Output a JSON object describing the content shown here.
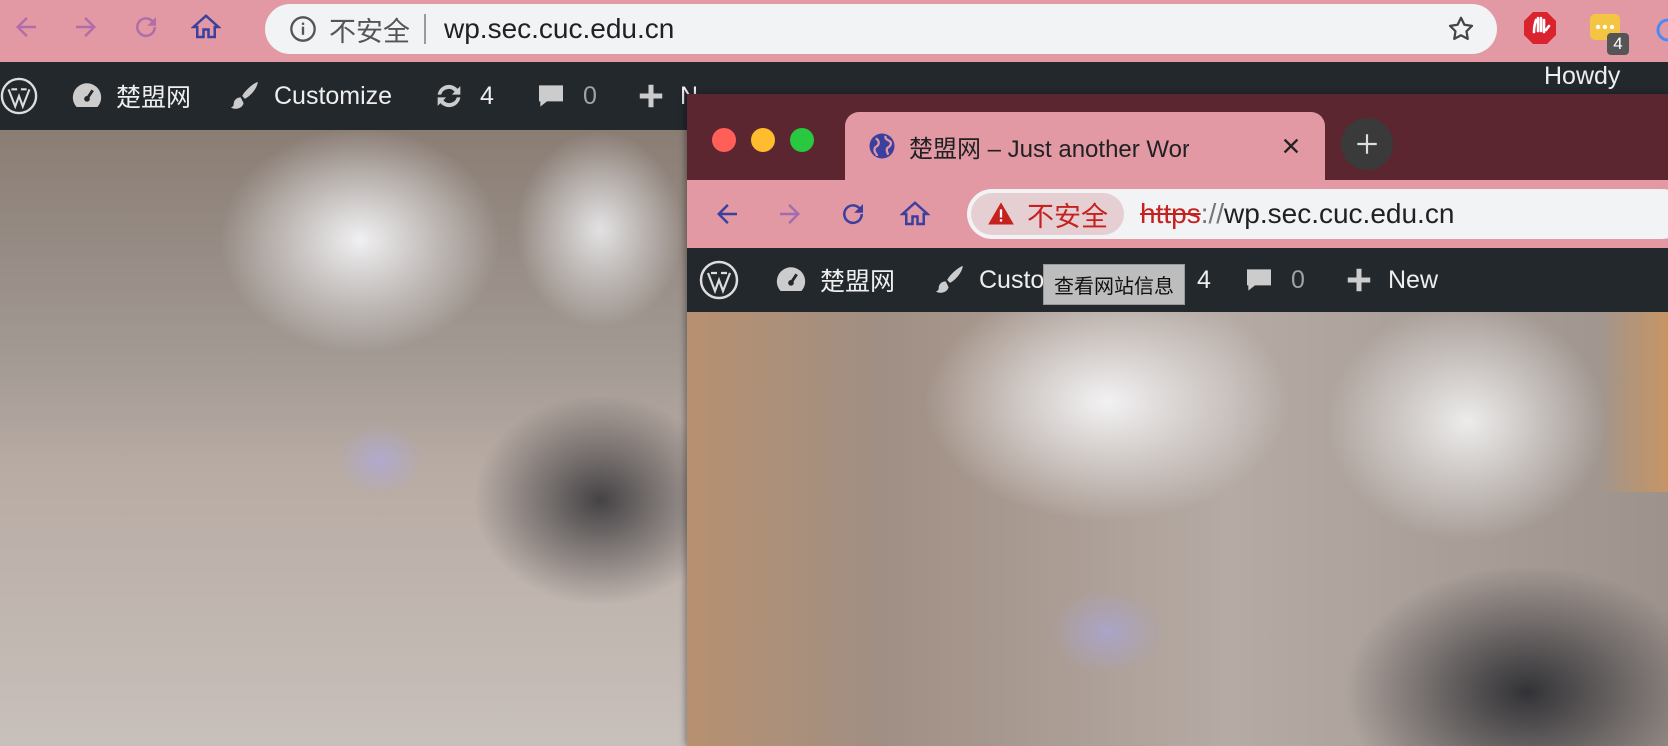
{
  "back_window": {
    "omnibox": {
      "security_label": "不安全",
      "url": "wp.sec.cuc.edu.cn"
    },
    "extensions": {
      "badge_count": "4"
    },
    "admin_bar": {
      "site_name": "楚盟网",
      "customize_label": "Customize",
      "updates_count": "4",
      "comments_count": "0",
      "new_label": "N",
      "howdy_label": "Howdy"
    }
  },
  "front_window": {
    "tab": {
      "title": "楚盟网 – Just another WordPress site"
    },
    "omnibox": {
      "security_label": "不安全",
      "url_scheme": "https",
      "url_separator": "://",
      "url_host": "wp.sec.cuc.edu.cn"
    },
    "admin_bar": {
      "site_name": "楚盟网",
      "customize_label": "Custo",
      "updates_count": "4",
      "comments_count": "0",
      "new_label": "New"
    },
    "tooltip": "查看网站信息"
  },
  "colors": {
    "toolbar_pink": "#e299a4",
    "tabstrip_maroon": "#5b2630",
    "adminbar_dark": "#23282d",
    "insecure_red": "#c5221f",
    "traffic_red": "#ff5f57",
    "traffic_yellow": "#febc2e",
    "traffic_green": "#28c840"
  }
}
